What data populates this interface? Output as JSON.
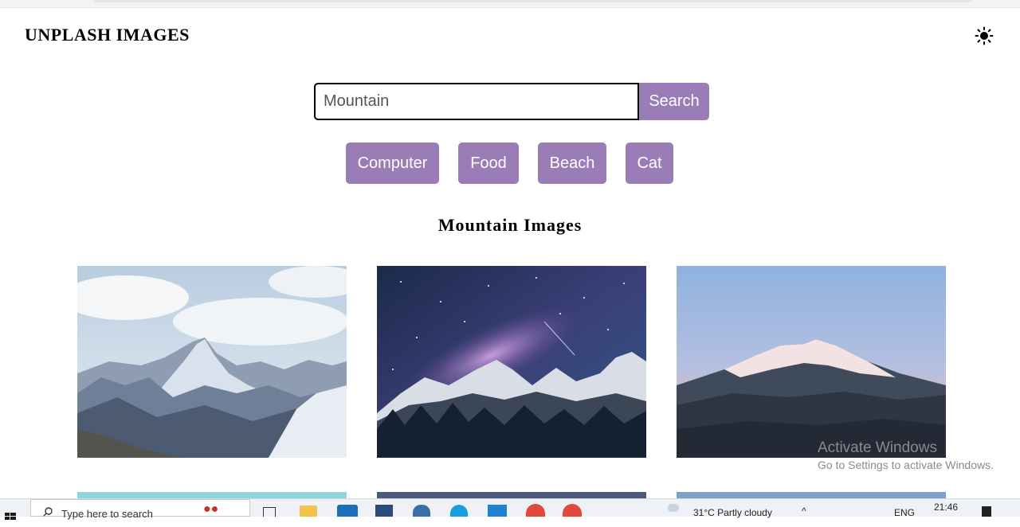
{
  "app": {
    "title": "UNPLASH IMAGES",
    "theme_icon": "sun-icon"
  },
  "search": {
    "value": "Mountain",
    "button_label": "Search"
  },
  "categories": [
    "Computer",
    "Food",
    "Beach",
    "Cat"
  ],
  "results": {
    "title": "Mountain Images",
    "images": [
      {
        "subject": "snowy-mountain-range"
      },
      {
        "subject": "milky-way-over-mountains"
      },
      {
        "subject": "mountain-peak-at-sunset"
      }
    ]
  },
  "watermark": {
    "line1": "Activate Windows",
    "line2": "Go to Settings to activate Windows."
  },
  "taskbar": {
    "search_placeholder": "Type here to search",
    "weather": "31°C  Partly cloudy",
    "language": "ENG",
    "time": "21:46"
  },
  "colors": {
    "accent": "#9a7db6",
    "background": "#ffffff",
    "text": "#000000"
  }
}
